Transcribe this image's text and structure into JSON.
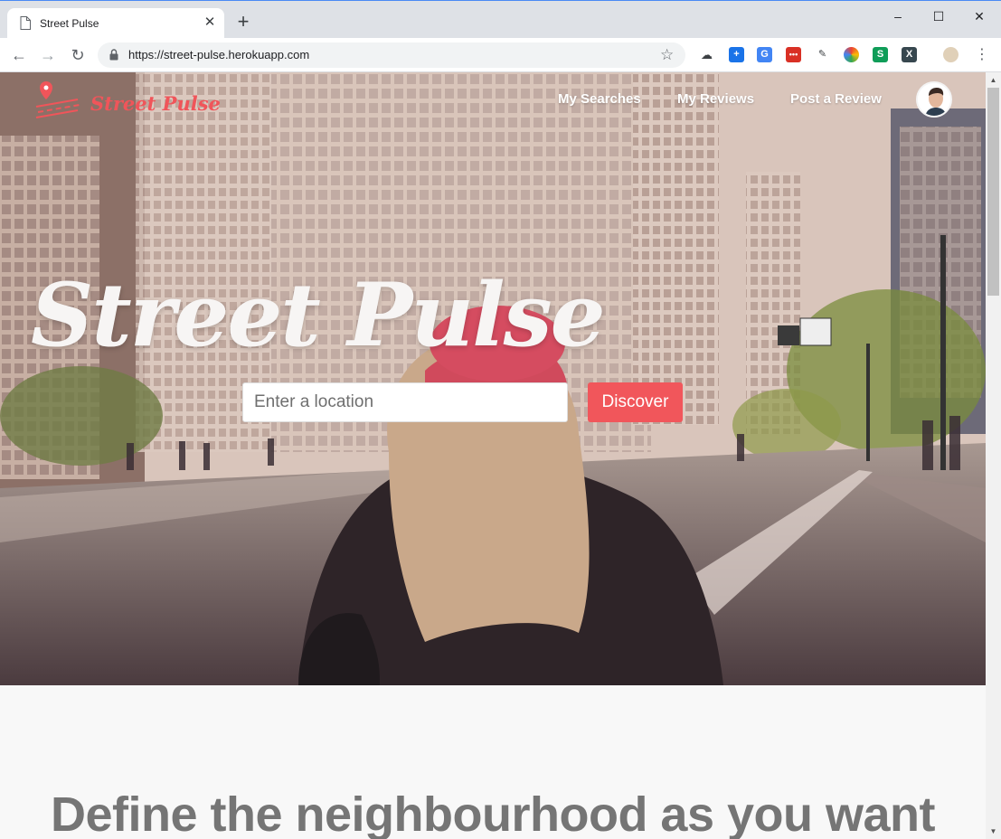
{
  "browser": {
    "tab_title": "Street Pulse",
    "url": "https://street-pulse.herokuapp.com",
    "colors": {
      "accent": "#4a8af4",
      "tabstrip": "#dee1e6"
    }
  },
  "site": {
    "brand_name": "Street Pulse",
    "brand_color": "#f0555a",
    "nav": {
      "my_searches": "My Searches",
      "my_reviews": "My Reviews",
      "post_review": "Post a Review"
    }
  },
  "hero": {
    "title": "Street Pulse",
    "search_placeholder": "Enter a location",
    "discover_label": "Discover",
    "discover_color": "#f1565b"
  },
  "section": {
    "heading": "Define the neighbourhood as you want"
  }
}
